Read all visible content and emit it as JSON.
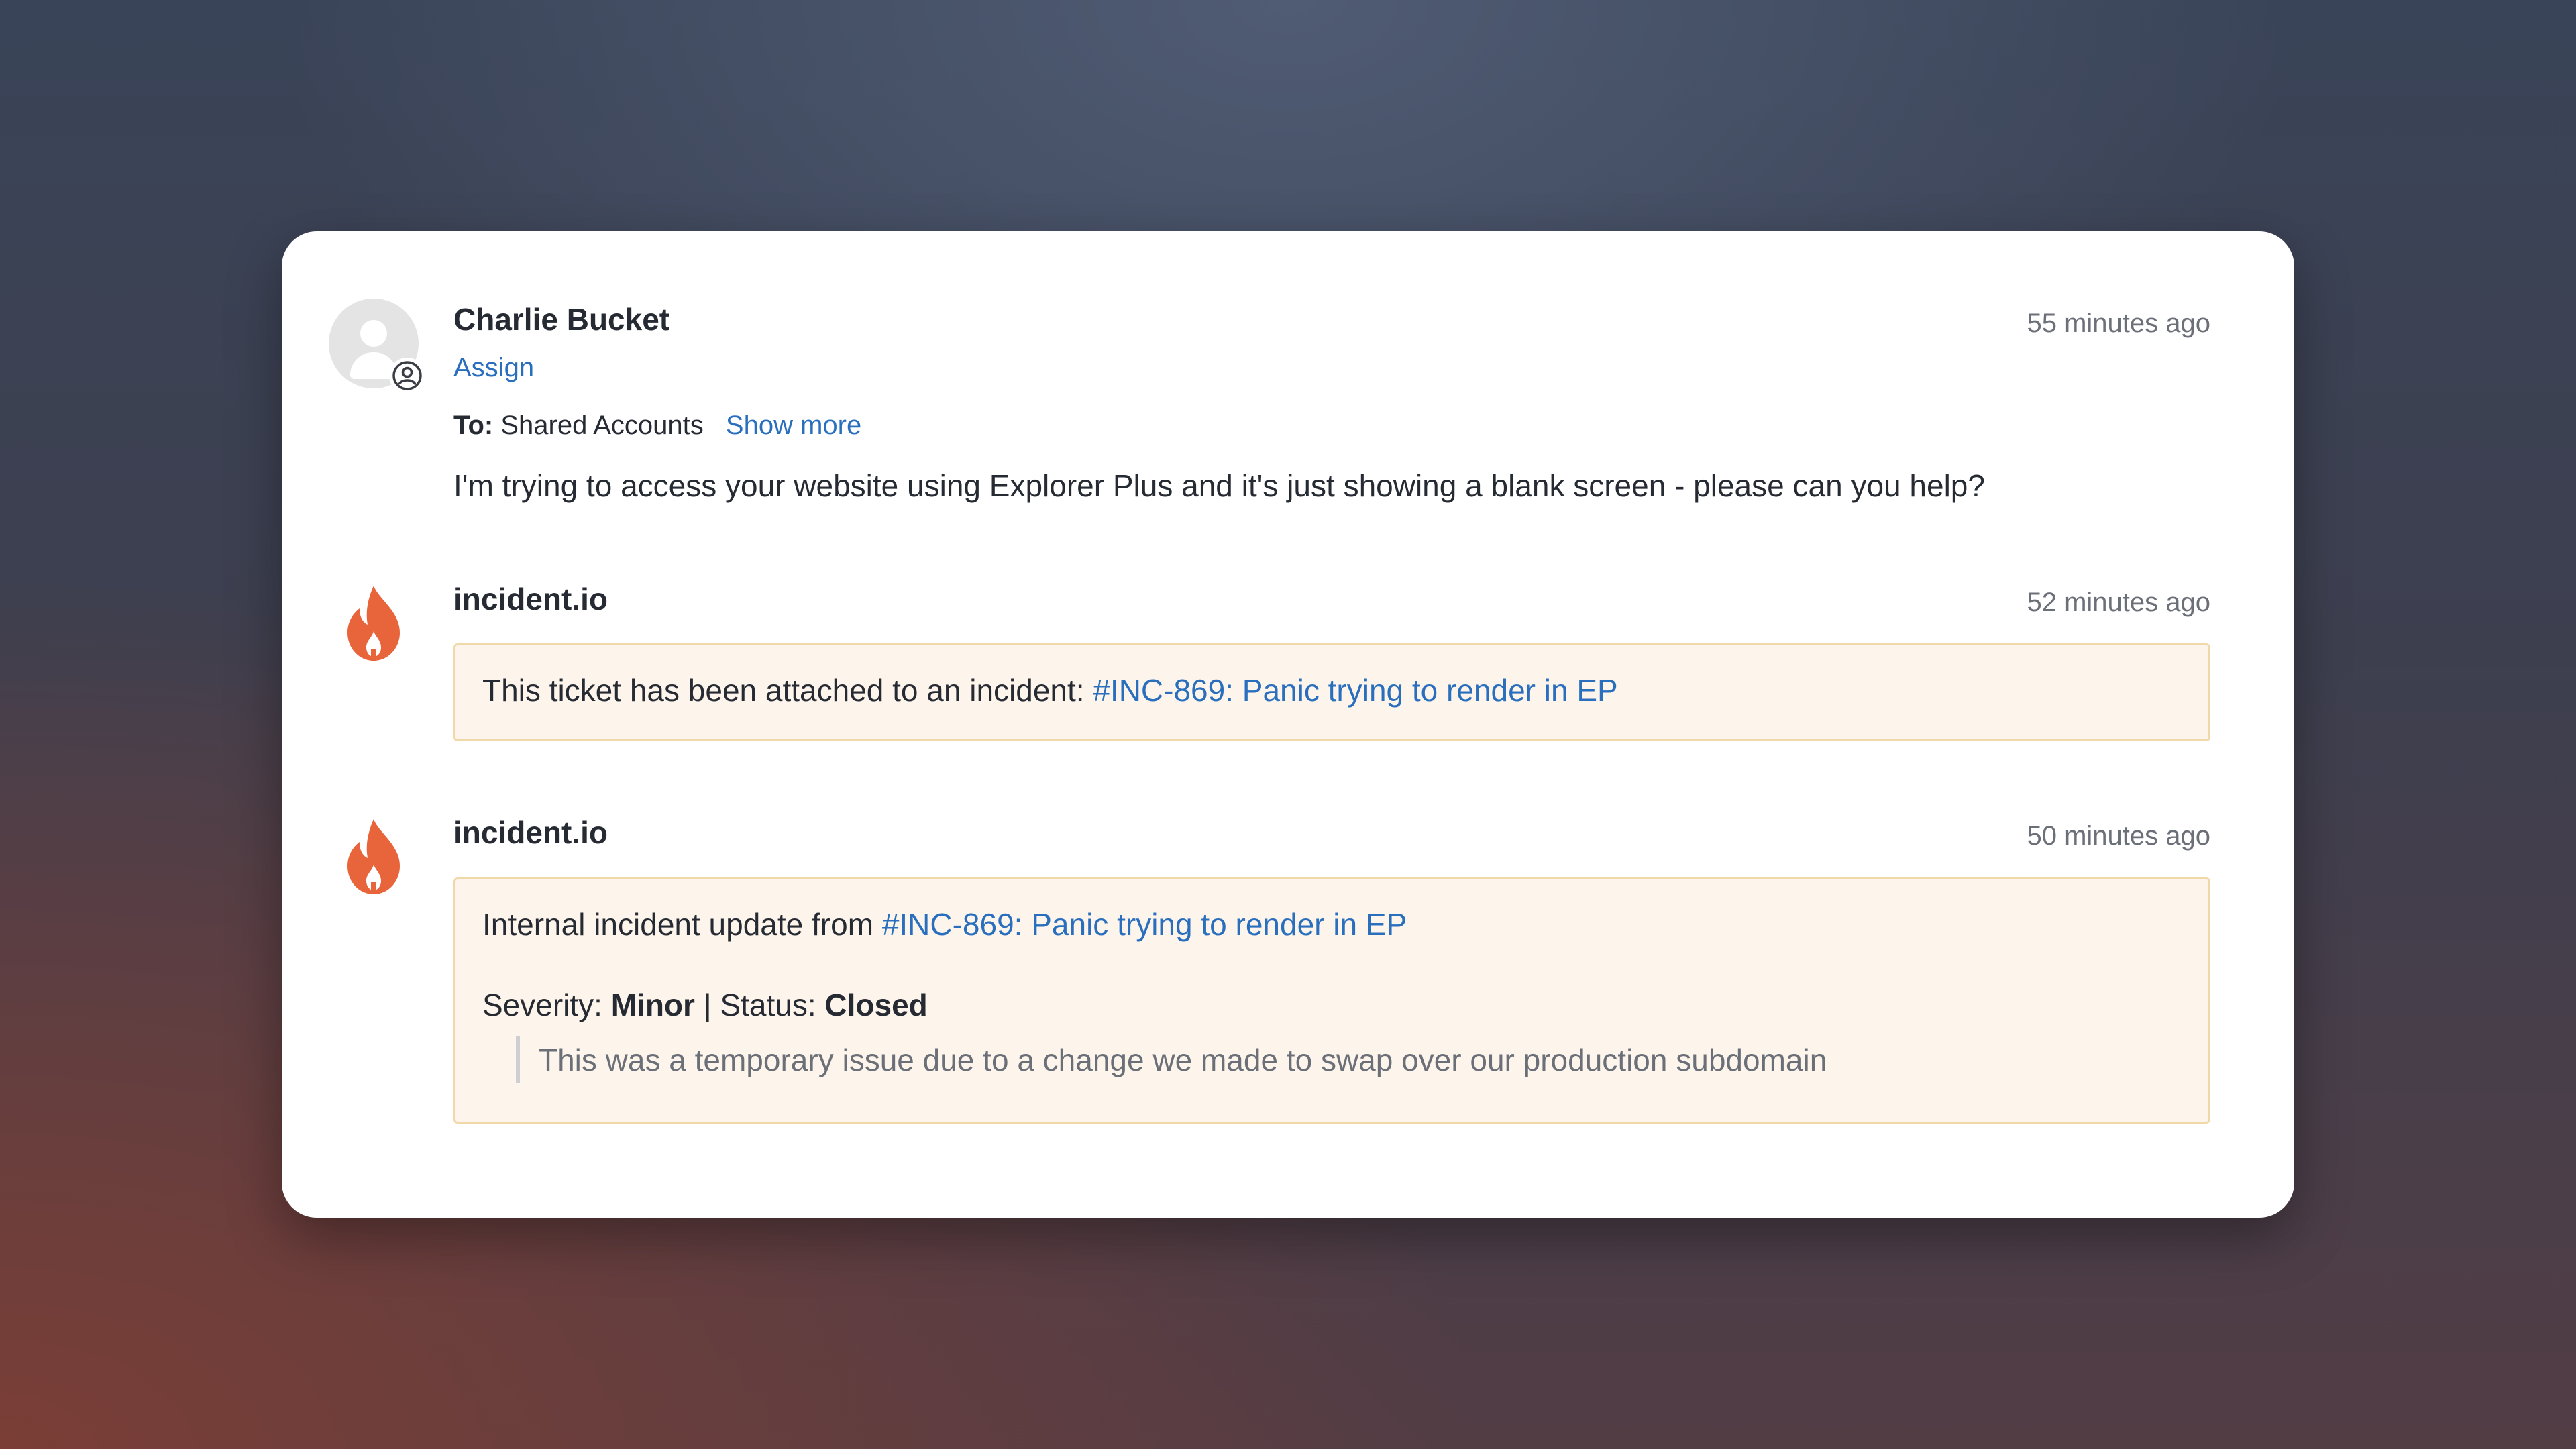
{
  "messages": [
    {
      "sender": "Charlie Bucket",
      "time": "55 minutes ago",
      "assign_label": "Assign",
      "to_label": "To:",
      "to_value": "Shared Accounts",
      "show_more_label": "Show more",
      "body": "I'm trying to access your website using Explorer Plus and it's just showing a blank screen - please can you help?",
      "icons": [
        "user-placeholder-icon",
        "user-circle-icon"
      ]
    },
    {
      "sender": "incident.io",
      "time": "52 minutes ago",
      "icon": "flame-icon",
      "text_prefix": "This ticket has been attached to an incident: ",
      "link_text": "#INC-869: Panic trying to render in EP"
    },
    {
      "sender": "incident.io",
      "time": "50 minutes ago",
      "icon": "flame-icon",
      "text_prefix": "Internal incident update from ",
      "link_text": "#INC-869: Panic trying to render in EP",
      "severity_label": "Severity: ",
      "severity_value": "Minor",
      "separator": " | Status: ",
      "status_value": "Closed",
      "quote": "This was a temporary issue due to a change we made to swap over our production subdomain"
    }
  ],
  "colors": {
    "link": "#2a6fbd",
    "flame": "#e8643a",
    "note_background": "#fdf5eb",
    "note_border": "#f1d8a8"
  }
}
